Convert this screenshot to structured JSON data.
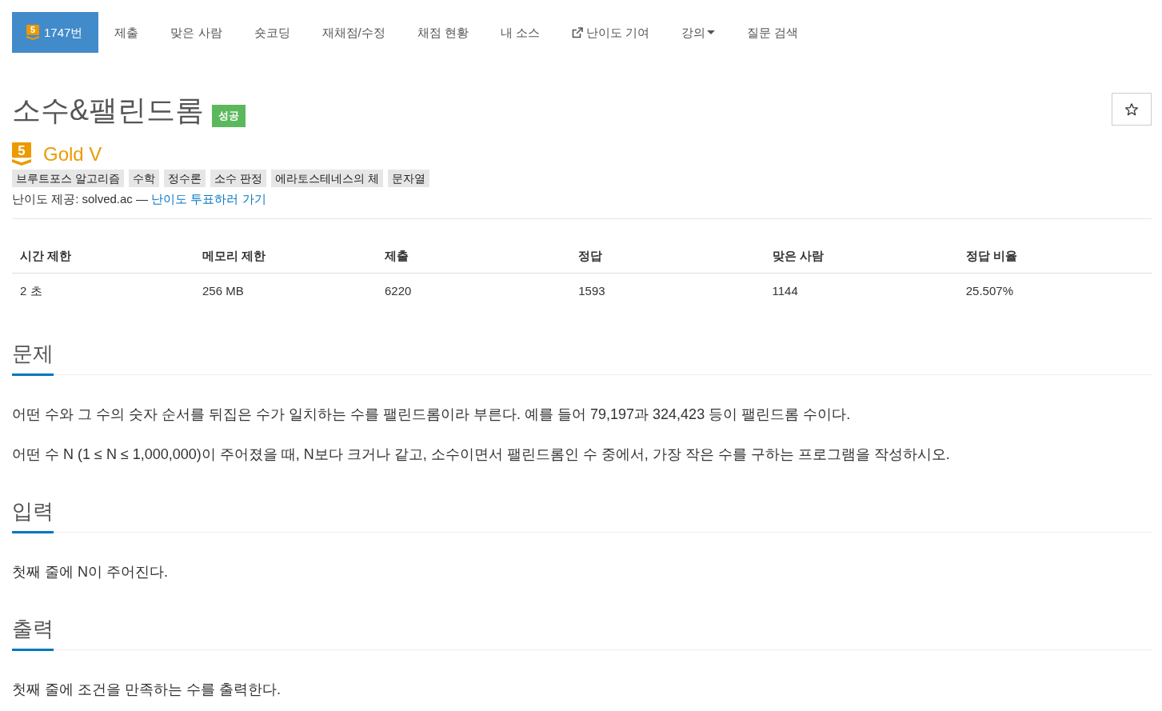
{
  "nav": {
    "items": [
      {
        "label": "1747번",
        "kind": "problem",
        "tier_mark": "5",
        "selected": true
      },
      {
        "label": "제출",
        "kind": "link",
        "selected": false
      },
      {
        "label": "맞은 사람",
        "kind": "link",
        "selected": false
      },
      {
        "label": "숏코딩",
        "kind": "link",
        "selected": false
      },
      {
        "label": "재채점/수정",
        "kind": "link",
        "selected": false
      },
      {
        "label": "채점 현황",
        "kind": "link",
        "selected": false
      },
      {
        "label": "내 소스",
        "kind": "link",
        "selected": false
      },
      {
        "label": "난이도 기여",
        "kind": "external",
        "selected": false
      },
      {
        "label": "강의",
        "kind": "dropdown",
        "selected": false
      },
      {
        "label": "질문 검색",
        "kind": "link",
        "selected": false
      }
    ]
  },
  "problem": {
    "title": "소수&팰린드롬",
    "result": {
      "label": "성공",
      "kind": "success"
    },
    "favorite": {
      "starred": false
    }
  },
  "tier": {
    "kind": "gold",
    "mark": "5",
    "name": "Gold V"
  },
  "tags": [
    "브루트포스 알고리즘",
    "수학",
    "정수론",
    "소수 판정",
    "에라토스테네스의 체",
    "문자열"
  ],
  "difficulty": {
    "prefix": "난이도 제공: solved.ac —",
    "link": "난이도 투표하러 가기"
  },
  "table": {
    "columns": [
      "시간 제한",
      "메모리 제한",
      "제출",
      "정답",
      "맞은 사람",
      "정답 비율"
    ],
    "rows": [
      [
        "2 초",
        "256 MB",
        "6220",
        "1593",
        "1144",
        "25.507%"
      ]
    ]
  },
  "sections": [
    {
      "title": "문제",
      "paragraphs": [
        "어떤 수와 그 수의 숫자 순서를 뒤집은 수가 일치하는 수를 팰린드롬이라 부른다. 예를 들어 79,197과 324,423 등이 팰린드롬 수이다.",
        "어떤 수 N (1 ≤ N ≤ 1,000,000)이 주어졌을 때, N보다 크거나 같고, 소수이면서 팰린드롬인 수 중에서, 가장 작은 수를 구하는 프로그램을 작성하시오."
      ]
    },
    {
      "title": "입력",
      "paragraphs": [
        "첫째 줄에 N이 주어진다."
      ]
    },
    {
      "title": "출력",
      "paragraphs": [
        "첫째 줄에 조건을 만족하는 수를 출력한다."
      ]
    }
  ]
}
